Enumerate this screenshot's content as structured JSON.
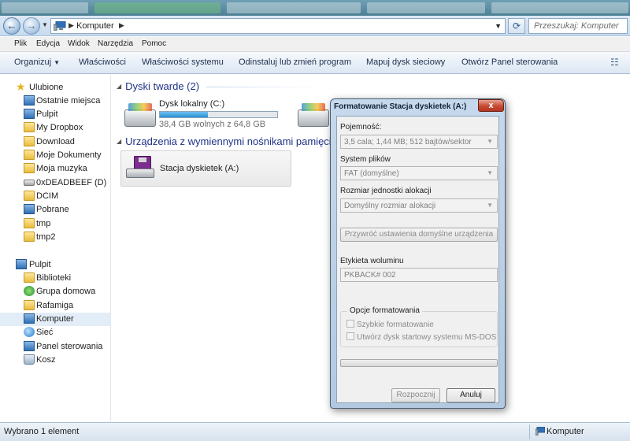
{
  "address": {
    "path": "Komputer",
    "search_placeholder": "Przeszukaj: Komputer"
  },
  "menu": [
    "Plik",
    "Edycja",
    "Widok",
    "Narzędzia",
    "Pomoc"
  ],
  "commands": {
    "organize": "Organizuj",
    "properties": "Właściwości",
    "system_properties": "Właściwości systemu",
    "uninstall": "Odinstaluj lub zmień program",
    "map_drive": "Mapuj dysk sieciowy",
    "control_panel": "Otwórz Panel sterowania"
  },
  "nav": {
    "favorites": [
      "Ulubione",
      "Ostatnie miejsca",
      "Pulpit",
      "My Dropbox",
      "Download",
      "Moje Dokumenty",
      "Moja muzyka",
      "0xDEADBEEF (D)",
      "DCIM",
      "Pobrane",
      "tmp",
      "tmp2"
    ],
    "desktop": [
      "Pulpit",
      "Biblioteki",
      "Grupa domowa",
      "Rafamiga",
      "Komputer",
      "Sieć",
      "Panel sterowania",
      "Kosz"
    ]
  },
  "content": {
    "hard_disks_header": "Dyski twarde (2)",
    "local_disk": {
      "name": "Dysk lokalny (C:)",
      "free": "38,4 GB wolnych z 64,8 GB",
      "used_fraction": 0.41
    },
    "removable_header": "Urządzenia z wymiennymi nośnikami pamięci (",
    "floppy_name": "Stacja dyskietek (A:)"
  },
  "status": {
    "left": "Wybrano 1 element",
    "right": "Komputer"
  },
  "dialog": {
    "title": "Formatowanie Stacja dyskietek (A:)",
    "close": "x",
    "capacity_label": "Pojemność:",
    "capacity_value": "3,5 cala;  1,44 MB; 512 bajtów/sektor",
    "fs_label": "System plików",
    "fs_value": "FAT (domyślne)",
    "alloc_label": "Rozmiar jednostki alokacji",
    "alloc_value": "Domyślny rozmiar alokacji",
    "restore_defaults": "Przywróć ustawienia domyślne urządzenia",
    "volume_label": "Etykieta woluminu",
    "volume_value": "PKBACK# 002",
    "options_label": "Opcje formatowania",
    "quick_format": "Szybkie formatowanie",
    "msdos_disk": "Utwórz dysk startowy systemu MS-DOS",
    "start": "Rozpocznij",
    "cancel": "Anuluj"
  }
}
